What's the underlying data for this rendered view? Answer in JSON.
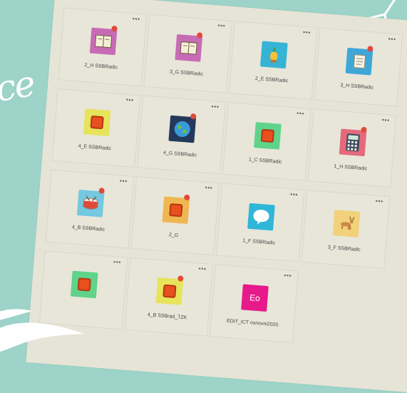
{
  "decor": {
    "script_text": "ce"
  },
  "apps": [
    {
      "label": "2_H SSBRadic",
      "icon": "book-icon",
      "bg": "#c86bb5",
      "badge": true
    },
    {
      "label": "3_G SSBRadic",
      "icon": "book-icon",
      "bg": "#c86bb5",
      "badge": true
    },
    {
      "label": "2_E SSBRadic",
      "icon": "pineapple-icon",
      "bg": "#37b3d6",
      "badge": false
    },
    {
      "label": "3_H SSBRadic",
      "icon": "scroll-icon",
      "bg": "#3fa7d8",
      "badge": true
    },
    {
      "label": "4_E SSBRadic",
      "icon": "orange-square-icon",
      "bg": "#e7e35a",
      "badge": false
    },
    {
      "label": "4_G SSBRadic",
      "icon": "globe-icon",
      "bg": "#23395b",
      "badge": true
    },
    {
      "label": "1_C SSBRadic",
      "icon": "orange-square-icon",
      "bg": "#5fd38a",
      "badge": false
    },
    {
      "label": "1_H SSBRadic",
      "icon": "calculator-icon",
      "bg": "#e36a7c",
      "badge": true
    },
    {
      "label": "4_B SSBRadic",
      "icon": "drum-icon",
      "bg": "#74c8e0",
      "badge": true
    },
    {
      "label": "2_G",
      "icon": "orange-square-icon",
      "bg": "#efb752",
      "badge": true
    },
    {
      "label": "1_F SSBRadic",
      "icon": "chat-bubble-icon",
      "bg": "#2fb6d8",
      "badge": false
    },
    {
      "label": "3_F SSBRadic",
      "icon": "deer-icon",
      "bg": "#f1d17a",
      "badge": false
    },
    {
      "label": "",
      "icon": "orange-square-icon",
      "bg": "#5fd38a",
      "badge": false
    },
    {
      "label": "4_B SSBrad_TZK",
      "icon": "orange-square-icon",
      "bg": "#e7e35a",
      "badge": true
    },
    {
      "label": "EDIT_ICT osnovni2020",
      "icon": "eo-icon",
      "bg": "#e8198b",
      "badge": false,
      "text": "Eo"
    }
  ]
}
